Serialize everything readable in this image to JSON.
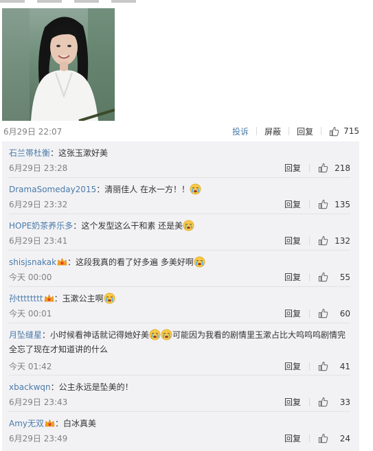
{
  "main_comment": {
    "image_alt": "portrait photo",
    "time": "6月29日 22:07",
    "report_label": "投诉",
    "block_label": "屏蔽",
    "reply_label": "回复",
    "likes": "715"
  },
  "reply_action_label": "回复",
  "replies": [
    {
      "user": "石兰帯杜衡",
      "badge": false,
      "colon": "：",
      "text": "这张玉漱好美",
      "emojis_after": [],
      "time": "6月29日 23:28",
      "likes": "218"
    },
    {
      "user": "DramaSomeday2015",
      "badge": false,
      "colon": "：",
      "text": "清丽佳人 在水一方！！",
      "emojis_after": [
        "crying-face"
      ],
      "time": "6月29日 23:32",
      "likes": "135"
    },
    {
      "user": "HOPE奶茶养乐多",
      "badge": false,
      "colon": "：",
      "text": "这个发型这么干和素 还是美",
      "emojis_after": [
        "crying-face"
      ],
      "time": "6月29日 23:41",
      "likes": "132"
    },
    {
      "user": "shisjsnakak",
      "badge": true,
      "colon": "：",
      "text": "这段我真的看了好多遍 多美好啊",
      "emojis_after": [
        "crying-face"
      ],
      "time": "今天 00:00",
      "likes": "55"
    },
    {
      "user": "孙tttttttt",
      "badge": true,
      "colon": "：",
      "text": "玉漱公主啊",
      "emojis_after": [
        "crying-face"
      ],
      "time": "今天 00:01",
      "likes": "60"
    },
    {
      "user": "月坠缝星",
      "badge": false,
      "colon": "：",
      "text": "小时候看神话就记得她好美",
      "emojis_after": [
        "crying-face",
        "crying-face"
      ],
      "text_after": "可能因为我看的剧情里玉漱占比大呜呜呜剧情完全忘了现在才知道讲的什么",
      "time": "今天 01:42",
      "likes": "41"
    },
    {
      "user": "xbackwqn",
      "badge": false,
      "colon": "：",
      "text": "公主永远是坠美的！",
      "emojis_after": [],
      "time": "6月29日 23:43",
      "likes": "33"
    },
    {
      "user": "Amy无双",
      "badge": true,
      "colon": "：",
      "text": "白冰真美",
      "emojis_after": [],
      "time": "6月29日 23:49",
      "likes": "24"
    }
  ],
  "colors": {
    "link": "#4a7aa8",
    "meta": "#808080",
    "reply_bg": "#f2f2f5"
  },
  "icons": {
    "like": "thumbs-up-icon",
    "emoji": "crying-face-icon",
    "badge": "vip-crown-icon"
  }
}
